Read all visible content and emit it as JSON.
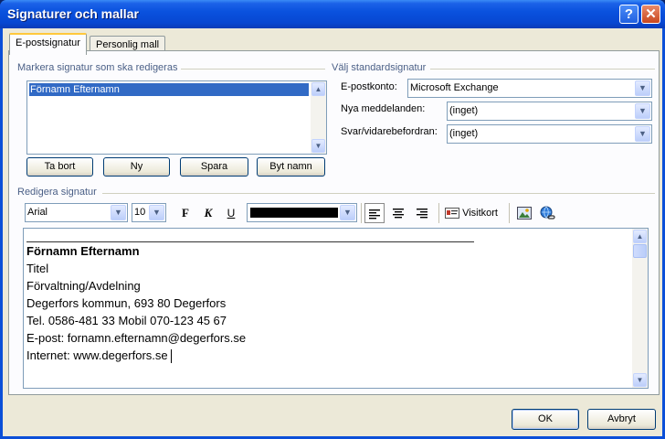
{
  "window": {
    "title": "Signaturer och mallar",
    "help_glyph": "?",
    "close_glyph": "✕"
  },
  "tabs": [
    {
      "label": "E-postsignatur",
      "active": true
    },
    {
      "label": "Personlig mall",
      "active": false
    }
  ],
  "select_signature": {
    "group_label": "Markera signatur som ska redigeras",
    "items": [
      "Förnamn Efternamn"
    ],
    "selected_index": 0
  },
  "buttons": {
    "delete": "Ta bort",
    "new": "Ny",
    "save": "Spara",
    "rename": "Byt namn",
    "ok": "OK",
    "cancel": "Avbryt"
  },
  "default_signature": {
    "group_label": "Välj standardsignatur",
    "account_label": "E-postkonto:",
    "account_value": "Microsoft Exchange",
    "new_messages_label": "Nya meddelanden:",
    "new_messages_value": "(inget)",
    "replies_label": "Svar/vidarebefordran:",
    "replies_value": "(inget)"
  },
  "edit_signature": {
    "group_label": "Redigera signatur",
    "font": "Arial",
    "size": "10",
    "bold_glyph": "F",
    "italic_glyph": "K",
    "underline_glyph": "U",
    "font_color": "#000000",
    "business_card_label": "Visitkort",
    "icons": [
      "align-left-icon",
      "align-center-icon",
      "align-right-icon",
      "business-card-icon",
      "insert-picture-icon",
      "insert-hyperlink-icon"
    ]
  },
  "signature_text": {
    "name": "Förnamn Efternamn",
    "title": "Titel",
    "department": "Förvaltning/Avdelning",
    "address": "Degerfors kommun, 693 80 Degerfors",
    "phone": "Tel. 0586-481 33 Mobil 070-123 45 67",
    "email": "E-post: fornamn.efternamn@degerfors.se",
    "web": "Internet: www.degerfors.se"
  },
  "colors": {
    "titlebar": "#0a52de",
    "selection": "#316ac5",
    "tab_highlight": "#ffc83c"
  }
}
